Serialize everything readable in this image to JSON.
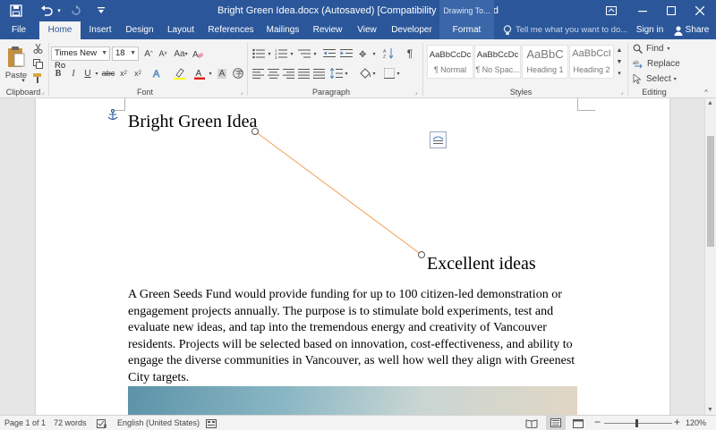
{
  "titlebar": {
    "title": "Bright Green Idea.docx (Autosaved) [Compatibility Mode] - Word",
    "contextual_group": "Drawing To...",
    "save_icon": "save-icon",
    "undo_icon": "undo-icon",
    "redo_icon": "redo-icon"
  },
  "tabs": {
    "file": "File",
    "home": "Home",
    "insert": "Insert",
    "design": "Design",
    "layout": "Layout",
    "references": "References",
    "mailings": "Mailings",
    "review": "Review",
    "view": "View",
    "developer": "Developer",
    "format": "Format",
    "tell_me": "Tell me what you want to do...",
    "sign_in": "Sign in",
    "share": "Share"
  },
  "ribbon": {
    "clipboard": {
      "label": "Clipboard",
      "paste": "Paste"
    },
    "font": {
      "label": "Font",
      "font_name": "Times New Ro",
      "font_size": "18"
    },
    "paragraph": {
      "label": "Paragraph"
    },
    "styles": {
      "label": "Styles",
      "items": [
        {
          "sample": "AaBbCcDc",
          "name": "¶ Normal"
        },
        {
          "sample": "AaBbCcDc",
          "name": "¶ No Spac..."
        },
        {
          "sample": "AaBbC",
          "name": "Heading 1"
        },
        {
          "sample": "AaBbCcI",
          "name": "Heading 2"
        }
      ]
    },
    "editing": {
      "label": "Editing",
      "find": "Find",
      "replace": "Replace",
      "select": "Select"
    }
  },
  "document": {
    "heading1": "Bright Green Idea",
    "heading2": "Excellent ideas",
    "body": "A Green Seeds Fund would provide funding for up to 100 citizen-led demonstration or engagement projects annually. The purpose is to stimulate bold experiments, test and evaluate new ideas, and tap into the tremendous energy and creativity of Vancouver residents. Projects will be selected based on innovation, cost-effectiveness, and ability to engage the diverse communities in Vancouver, as well how well they align with Greenest City targets.",
    "connector_color": "#f0a050"
  },
  "statusbar": {
    "page": "Page 1 of 1",
    "words": "72 words",
    "language": "English (United States)",
    "zoom": "120%"
  },
  "colors": {
    "accent": "#2b579a",
    "ribbon_bg": "#f3f3f3",
    "font_color_underline": "#e02020",
    "highlight_underline": "#ffff00"
  }
}
